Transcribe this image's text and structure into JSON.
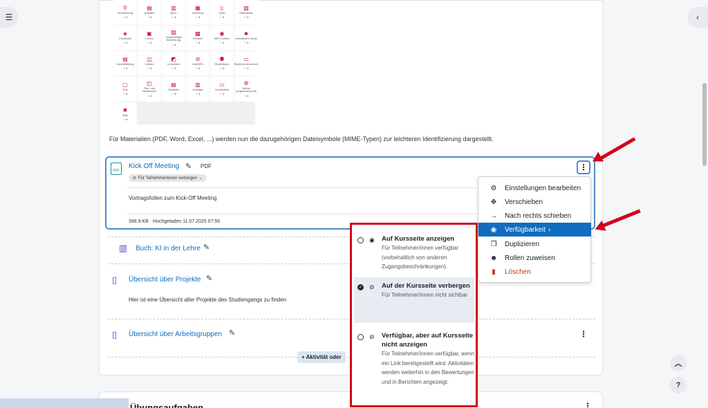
{
  "grid_tiles": [
    {
      "label": "Abstimmung",
      "icon": "⚲"
    },
    {
      "label": "Aufgabe",
      "icon": "▤"
    },
    {
      "label": "Buch",
      "icon": "▥"
    },
    {
      "label": "Buchung",
      "icon": "▦"
    },
    {
      "label": "Datei",
      "icon": "▯"
    },
    {
      "label": "Datenbank",
      "icon": "▨"
    },
    {
      "label": "Feedback",
      "icon": "◈"
    },
    {
      "label": "Forum",
      "icon": "▣"
    },
    {
      "label": "Gegenseitige Beurteilung",
      "icon": "▧"
    },
    {
      "label": "Glossar",
      "icon": "▩"
    },
    {
      "label": "H5P-Content",
      "icon": "◉"
    },
    {
      "label": "Interaktives Inhalt",
      "icon": "■"
    },
    {
      "label": "Kursmitteilung",
      "icon": "▤"
    },
    {
      "label": "Lektion",
      "icon": "◫"
    },
    {
      "label": "Lernpaket",
      "icon": "◩"
    },
    {
      "label": "Link/URL",
      "icon": "⊘"
    },
    {
      "label": "Studentquiz",
      "icon": "⚉"
    },
    {
      "label": "Studierendenordner",
      "icon": "▭"
    },
    {
      "label": "Test",
      "icon": "▢"
    },
    {
      "label": "Text- und Medienfeld",
      "icon": "◰"
    },
    {
      "label": "Textseite",
      "icon": "▤"
    },
    {
      "label": "Umfrage",
      "icon": "▥"
    },
    {
      "label": "Verzeichnis",
      "icon": "▭"
    },
    {
      "label": "Virtual programming lab",
      "icon": "⚙"
    },
    {
      "label": "Wiki",
      "icon": "✱"
    }
  ],
  "info_text": "Für Materialien (PDF, Word, Excel, ...) werden nun die dazugehörigen Dateisymbole (MIME-Typen) zur leichteren Identifizierung dargestellt.",
  "activity": {
    "icon_text": "PDF",
    "title": "Kick Off Meeting",
    "type": "PDF",
    "badge": "Für Teilnehmer/innen verborgen",
    "description": "Vortragsfolien zum Kick-Off Meeting",
    "meta": "398.9 KB · Hochgeladen 11.07.2025 07:56"
  },
  "book": {
    "title": "Buch: KI in der Lehre"
  },
  "projects": {
    "title": "Übersicht über Projekte",
    "description": "Hier ist eine Übersicht aller Projekte des Studiengangs zu finden"
  },
  "groups": {
    "title": "Übersicht über Arbeitsgruppen"
  },
  "add_button": "+ Aktivität oder",
  "next_section": "Übungsaufgaben",
  "menu": {
    "items": [
      {
        "label": "Einstellungen bearbeiten",
        "icon": "gear-icon"
      },
      {
        "label": "Verschieben",
        "icon": "move-icon"
      },
      {
        "label": "Nach rechts schieben",
        "icon": "arrow-right-icon"
      },
      {
        "label": "Verfügbarkeit",
        "icon": "eye-icon"
      },
      {
        "label": "Duplizieren",
        "icon": "copy-icon"
      },
      {
        "label": "Rollen zuweisen",
        "icon": "user-icon"
      },
      {
        "label": "Löschen",
        "icon": "trash-icon"
      }
    ]
  },
  "availability": {
    "options": [
      {
        "title": "Auf Kursseite anzeigen",
        "desc": "Für Teilnehmer/innen verfügbar (vorbehaltlich von anderen Zugangsbeschränkungen).",
        "selected": false
      },
      {
        "title": "Auf der Kursseite verbergen",
        "desc": "Für Teilnehmer/innen nicht sichtbar",
        "selected": true
      },
      {
        "title": "Verfügbar, aber auf Kursseite nicht anzeigen",
        "desc": "Für Teilnehmer/innen verfügbar, wenn ein Link bereitgestellt wird. Aktivitäten werden weiterhin in den Bewertungen und in Berichten angezeigt.",
        "selected": false
      }
    ]
  },
  "colors": {
    "accent": "#0f6cbf",
    "highlight": "#d0021b",
    "danger": "#ca3120"
  }
}
